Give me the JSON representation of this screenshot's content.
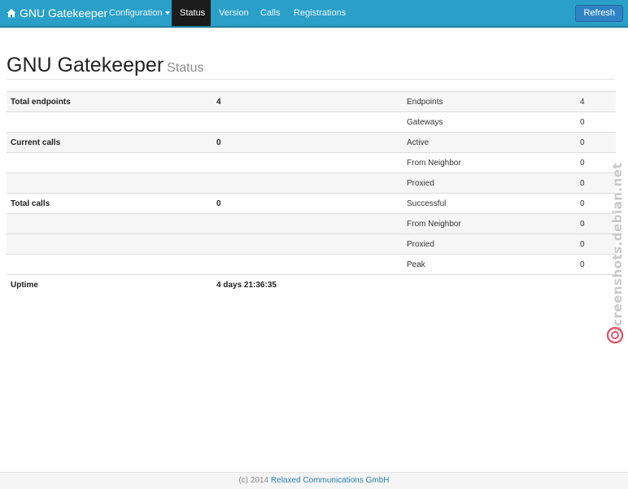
{
  "navbar": {
    "brand": "GNU Gatekeeper",
    "items": [
      {
        "label": "Configuration"
      },
      {
        "label": "Status"
      },
      {
        "label": "Version"
      },
      {
        "label": "Calls"
      },
      {
        "label": "Registrations"
      }
    ],
    "refresh_label": "Refresh",
    "accent_color": "#2aa0c8",
    "active_color": "#1b1b1b"
  },
  "header": {
    "title": "GNU Gatekeeper",
    "subtitle": "Status"
  },
  "table": {
    "rows": [
      {
        "label": "Total endpoints",
        "value": "4",
        "sub_label": "Endpoints",
        "sub_value": "4"
      },
      {
        "label": "",
        "value": "",
        "sub_label": "Gateways",
        "sub_value": "0"
      },
      {
        "label": "Current calls",
        "value": "0",
        "sub_label": "Active",
        "sub_value": "0"
      },
      {
        "label": "",
        "value": "",
        "sub_label": "From Neighbor",
        "sub_value": "0"
      },
      {
        "label": "",
        "value": "",
        "sub_label": "Proxied",
        "sub_value": "0"
      },
      {
        "label": "Total calls",
        "value": "0",
        "sub_label": "Successful",
        "sub_value": "0"
      },
      {
        "label": "",
        "value": "",
        "sub_label": "From Neighbor",
        "sub_value": "0"
      },
      {
        "label": "",
        "value": "",
        "sub_label": "Proxied",
        "sub_value": "0"
      },
      {
        "label": "",
        "value": "",
        "sub_label": "Peak",
        "sub_value": "0"
      },
      {
        "label": "Uptime",
        "value": "4 days 21:36:35",
        "sub_label": "",
        "sub_value": ""
      }
    ]
  },
  "footer": {
    "copyright": "(c) 2014",
    "company": "Relaxed Communications GmbH"
  },
  "watermark": {
    "text": "screenshots.debian.net",
    "icon": "debian-swirl-icon"
  }
}
